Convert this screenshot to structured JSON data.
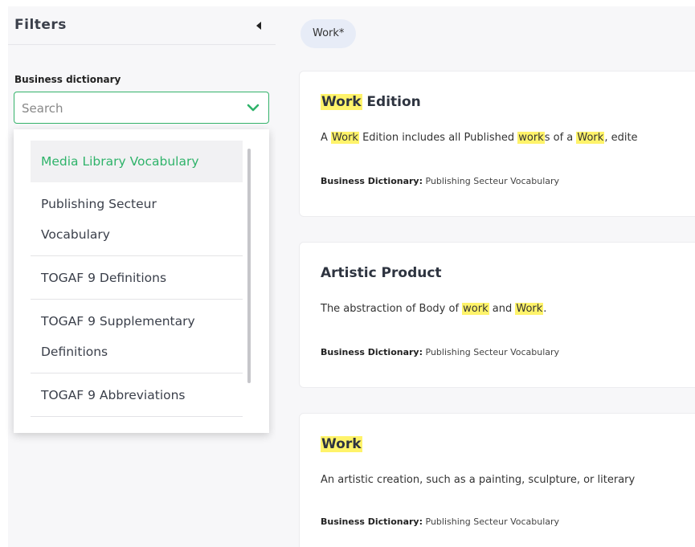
{
  "filters": {
    "title": "Filters",
    "section_label": "Business dictionary",
    "search_placeholder": "Search",
    "options": [
      {
        "label": "Media Library Vocabulary",
        "selected": true
      },
      {
        "label_line1": "Publishing Secteur",
        "label_line2": "Vocabulary",
        "selected": false
      },
      {
        "label": "TOGAF 9 Definitions",
        "selected": false
      },
      {
        "label_line1": "TOGAF 9 Supplementary",
        "label_line2": "Definitions",
        "selected": false
      },
      {
        "label": "TOGAF 9 Abbreviations",
        "selected": false
      }
    ]
  },
  "search_chip": "Work*",
  "results": [
    {
      "title_highlight": "Work",
      "title_rest": " Edition",
      "desc": [
        {
          "t": "A ",
          "h": false
        },
        {
          "t": "Work",
          "h": true
        },
        {
          "t": " Edition includes all Published ",
          "h": false
        },
        {
          "t": "work",
          "h": true
        },
        {
          "t": "s of a ",
          "h": false
        },
        {
          "t": "Work",
          "h": true
        },
        {
          "t": ", edite",
          "h": false
        }
      ],
      "meta_label": "Business Dictionary:",
      "meta_value": " Publishing Secteur Vocabulary"
    },
    {
      "title_highlight": "",
      "title_rest": "Artistic Product",
      "desc": [
        {
          "t": "The abstraction of Body of ",
          "h": false
        },
        {
          "t": "work",
          "h": true
        },
        {
          "t": " and ",
          "h": false
        },
        {
          "t": "Work",
          "h": true
        },
        {
          "t": ".",
          "h": false
        }
      ],
      "meta_label": "Business Dictionary:",
      "meta_value": " Publishing Secteur Vocabulary"
    },
    {
      "title_highlight": "Work",
      "title_rest": "",
      "desc": [
        {
          "t": "An artistic creation, such as a painting, sculpture, or literary",
          "h": false
        }
      ],
      "meta_label": "Business Dictionary:",
      "meta_value": " Publishing Secteur Vocabulary"
    }
  ],
  "colors": {
    "accent": "#2fb36a",
    "highlight": "#fff36a",
    "chip_bg": "#e7ecf7"
  },
  "icons": {
    "collapse": "caret-left-icon",
    "dropdown": "chevron-down-icon"
  }
}
